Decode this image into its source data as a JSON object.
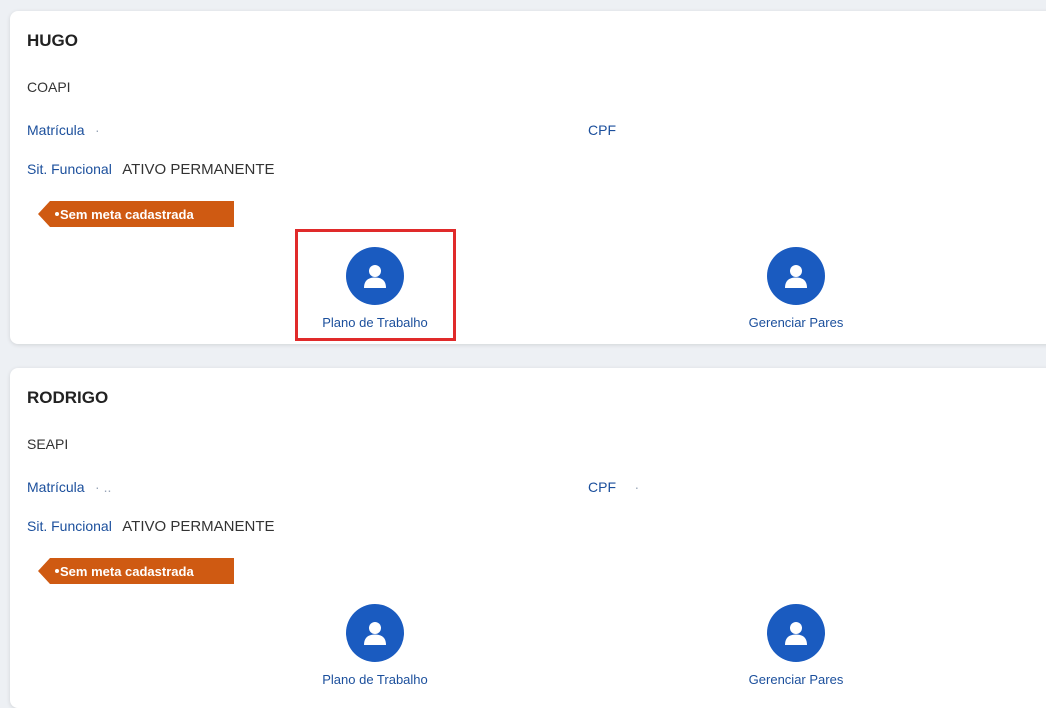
{
  "employees": [
    {
      "name": "HUGO",
      "unit": "COAPI",
      "matricula_label": "Matrícula",
      "matricula_value": "·",
      "cpf_label": "CPF",
      "cpf_value": "",
      "sit_label": "Sit. Funcional",
      "sit_value": "ATIVO PERMANENTE",
      "badge": "Sem meta cadastrada",
      "actions": [
        "Plano de Trabalho",
        "Gerenciar Pares"
      ],
      "highlighted_action": "Plano de Trabalho"
    },
    {
      "name": "RODRIGO",
      "unit": "SEAPI",
      "matricula_label": "Matrícula",
      "matricula_value": "· ..",
      "cpf_label": "CPF",
      "cpf_value": "·",
      "sit_label": "Sit. Funcional",
      "sit_value": "ATIVO PERMANENTE",
      "badge": "Sem meta cadastrada",
      "actions": [
        "Plano de Trabalho",
        "Gerenciar Pares"
      ]
    }
  ],
  "icons": {
    "action_icon": "user-icon"
  },
  "colors": {
    "accent": "#1a5bc0",
    "label": "#1b4f9c",
    "badge": "#cf5a12",
    "highlight": "#e02a2a"
  }
}
